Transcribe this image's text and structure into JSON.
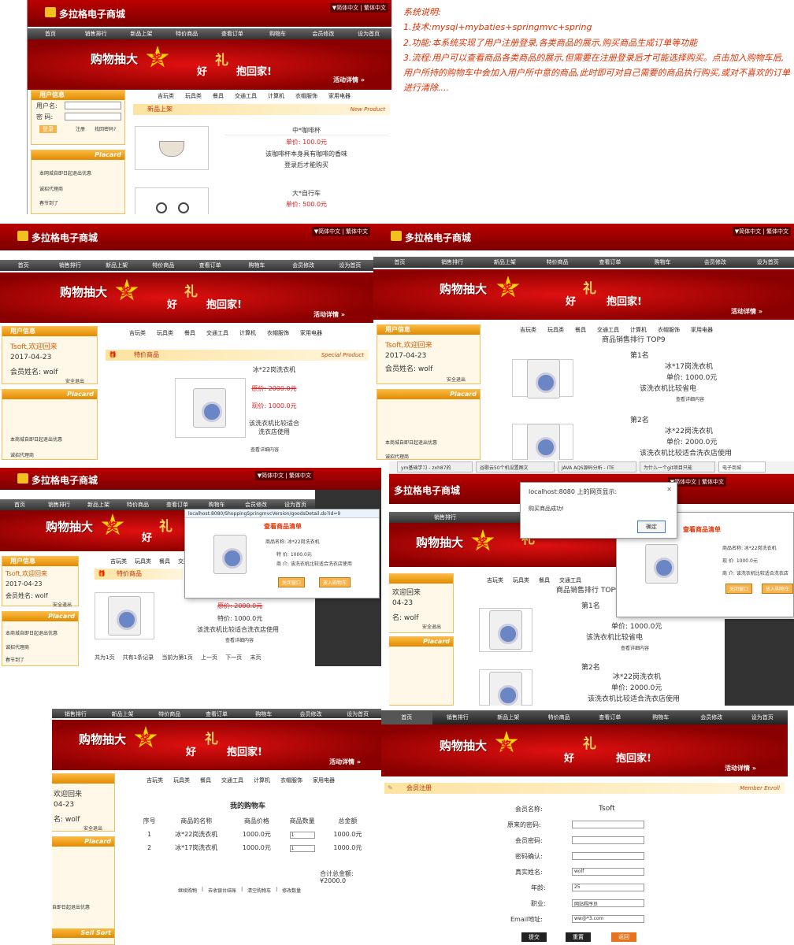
{
  "site": {
    "name": "多拉格电子商城",
    "lang": "▼简体中文 | 繁体中文"
  },
  "nav": [
    "首页",
    "销售排行",
    "新品上架",
    "特价商品",
    "查看订单",
    "购物车",
    "会员修改",
    "设为首页"
  ],
  "banner": {
    "a": "购物抽大",
    "burst": "奖",
    "b": "好",
    "c": "礼",
    "d": "抱回家!",
    "more": "活动详情 »"
  },
  "cats": [
    "吉玩类",
    "玩具类",
    "餐具",
    "交通工具",
    "计算机",
    "衣帽服饰",
    "家用电器"
  ],
  "desc": {
    "title": "系统说明:",
    "l1": "1.技术:mysql+mybaties+springmvc+spring",
    "l2": "2.功能:本系统实现了用户注册登录,各类商品的展示,购买商品生成订单等功能",
    "l3": "3.流程:用户可以查看商品各类商品的展示,但需要在注册登录后才可能选择购买。点击加入购物车后,用户所持的购物车中会加入用户所中意的商品,此时即可对自己需要的商品执行购买,或对不喜欢的订单进行清除...."
  },
  "p1": {
    "userbox": "用户信息",
    "uname": "用户名:",
    "pwd": "密 码:",
    "login": "登录",
    "reg": "注册",
    "forgot": "找回密码?",
    "placard": "Placard",
    "n1": "本网城自即日起退出优惠",
    "n2": "诚招代理商",
    "n3": "春节到了",
    "newsec": "新品上架",
    "newsec_en": "New Product",
    "prod1": {
      "name": "中*咖啡杯",
      "price": "单价: 100.0元",
      "desc": "该咖啡杯本身具有咖啡的香味",
      "note": "登录后才能购买"
    },
    "prod2": {
      "name": "大*自行车",
      "price": "单价: 500.0元"
    }
  },
  "p2": {
    "user": "Tsoft,欢迎回来",
    "date": "2017-04-23",
    "member": "会员姓名: wolf",
    "logout": "安全退出",
    "placard": "Placard",
    "n1": "本商城自即日起退出优惠",
    "n2": "诚招代理商",
    "sec": "特价商品",
    "sec_en": "Special Product",
    "name": "冰*22岗洗衣机",
    "old": "原价: 2000.0元",
    "now": "现价: 1000.0元",
    "desc": "该洗衣机比较适合洗衣店使用",
    "detail": "查看详细内容"
  },
  "p3": {
    "rank": "商品销售排行 TOP9",
    "r1": "第1名",
    "r1name": "冰*17岗洗衣机",
    "r1price": "单价: 1000.0元",
    "r1desc": "该洗衣机比较省电",
    "detail": "查看详细内容",
    "r2": "第2名",
    "r2name": "冰*22岗洗衣机",
    "r2price": "单价: 2000.0元",
    "r2desc": "该洗衣机比较适合洗衣店使用",
    "user": "Tsoft,欢迎回来",
    "date": "2017-04-23",
    "member": "会员姓名: wolf",
    "logout": "安全退出",
    "placard": "Placard",
    "n1": "本商城自即日起退出优惠",
    "n2": "诚招代理商"
  },
  "p4": {
    "url": "localhost:8080/ShoppingSpringmvcVersion/goodsDetail.do?id=9",
    "poptitle": "查看商品清单",
    "pname": "商品名称: 冰*22岗洗衣机",
    "pprice": "特 价: 1000.0元",
    "pdesc": "商 介: 该洗衣机比较适合洗衣店使用",
    "close": "关闭窗口",
    "add": "放入购物车",
    "old": "原价: 2000.0元",
    "now": "特价: 1000.0元",
    "desc": "该洗衣机比较适合洗衣店使用",
    "detail": "查看详细内容",
    "pager": "共为1页 共有1条记录 当前为第1页 上一页 下一页 末页",
    "user": "Tsoft,欢迎回来",
    "date": "2017-04-23",
    "member": "会员姓名: wolf",
    "logout": "安全退出",
    "placard": "Placard",
    "n1": "本商城自即日起退出优惠",
    "n2": "诚招代理商",
    "n3": "春节到了",
    "sec": "特价商品"
  },
  "p5": {
    "tabs": [
      "ym基础学习 - zxh87的",
      "谷歌云50个机设置图文",
      "JAVA AQS源码分析 - ITE",
      "为什么一个git项目只能",
      "电子商城"
    ],
    "alert_title": "localhost:8080 上的网页显示:",
    "alert_msg": "购买商品成功!",
    "ok": "确定",
    "poptitle": "查看商品清单",
    "pname": "商品名称: 冰*22岗洗衣机",
    "pprice": "现 价: 1000.0元",
    "pdesc": "商 介: 该洗衣机比较适合洗衣店",
    "close": "关闭窗口",
    "add": "放入购物车",
    "rank": "商品销售排行 TOP9",
    "r1": "第1名",
    "r1price": "单价: 1000.0元",
    "r1desc": "该洗衣机比较省电",
    "detail": "查看详细内容",
    "r2": "第2名",
    "r2name": "冰*22岗洗衣机",
    "r2price": "单价: 2000.0元",
    "r2desc": "该洗衣机比较适合洗衣店使用",
    "user": "欢迎回来",
    "date": "04-23",
    "member": "名: wolf",
    "logout": "安全退出",
    "placard": "Placard"
  },
  "p6": {
    "title": "我的购物车",
    "headers": [
      "序号",
      "商品的名称",
      "商品价格",
      "商品数量",
      "总金额"
    ],
    "rows": [
      [
        "1",
        "冰*22岗洗衣机",
        "1000.0元",
        "1",
        "1000.0元"
      ],
      [
        "2",
        "冰*17岗洗衣机",
        "1000.0元",
        "1",
        "1000.0元"
      ]
    ],
    "total": "合计总金额:",
    "total_val": "¥2000.0",
    "actions": [
      "继续购物",
      "去收银台结账",
      "清空购物车",
      "修改数量"
    ],
    "user": "欢迎回来",
    "date": "04-23",
    "member": "名: wolf",
    "logout": "安全退出",
    "placard": "Placard",
    "n1": "自即日起退出优惠",
    "n4": "Sell Sort"
  },
  "p7": {
    "sec": "会员注册",
    "sec_en": "Member Enroll",
    "labels": [
      "会员名称:",
      "原来的密码:",
      "会员密码:",
      "密码确认:",
      "真实姓名:",
      "年龄:",
      "职业:",
      "Email地址:"
    ],
    "values": [
      "Tsoft",
      "",
      "",
      "",
      "wolf",
      "25",
      "网站程序员",
      "ww@*3.com"
    ],
    "submit": "提交",
    "reset": "重置",
    "back": "返回"
  }
}
